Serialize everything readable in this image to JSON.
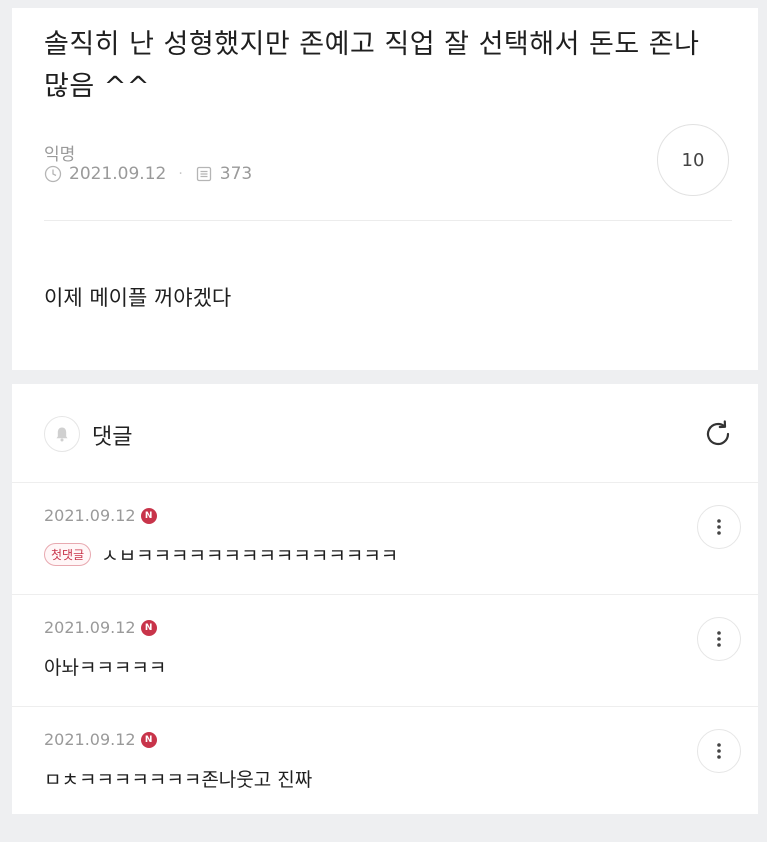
{
  "post": {
    "title": "솔직히 난 성형했지만 존예고 직업 잘 선택해서 돈도 존나 많음 ^^",
    "author": "익명",
    "date": "2021.09.12",
    "views": "373",
    "comment_count": "10",
    "body": "이제 메이플 꺼야겠다"
  },
  "comments_section": {
    "label": "댓글",
    "items": [
      {
        "date": "2021.09.12",
        "badge_n": "N",
        "first_badge": "첫댓글",
        "text": "ㅅㅂㅋㅋㅋㅋㅋㅋㅋㅋㅋㅋㅋㅋㅋㅋㅋ"
      },
      {
        "date": "2021.09.12",
        "badge_n": "N",
        "text": "아놔ㅋㅋㅋㅋㅋ"
      },
      {
        "date": "2021.09.12",
        "badge_n": "N",
        "text": "ㅁㅊㅋㅋㅋㅋㅋㅋㅋ존나웃고 진짜"
      }
    ]
  },
  "icons": {
    "clock": "clock-icon",
    "views": "document-icon",
    "bell": "bell-icon",
    "refresh": "refresh-icon",
    "more": "more-vertical-icon"
  },
  "colors": {
    "background": "#eeeff1",
    "card": "#ffffff",
    "muted_text": "#9a9a9a",
    "badge_red": "#c8344a"
  }
}
